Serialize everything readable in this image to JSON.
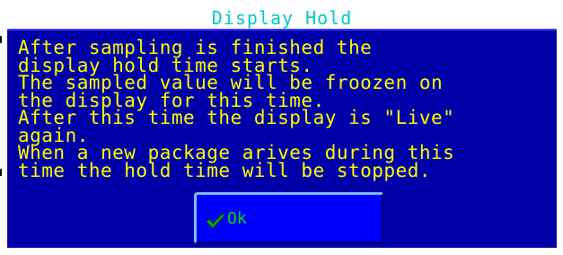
{
  "dialog": {
    "title": "Display Hold",
    "message_lines": [
      "After sampling is finished the",
      "display hold time starts.",
      "The sampled value will be froozen on",
      "the display for this time.",
      "After this time the display is \"Live\"",
      "again.",
      "When a new package arives during this",
      "time the hold time will be stopped."
    ],
    "ok_button": {
      "label": "Ok",
      "icon": "checkmark-icon"
    }
  },
  "colors": {
    "dialog_background": "#0000a8",
    "title_text": "#00c8c8",
    "message_text": "#ffff00",
    "button_background": "#0000ff",
    "button_label": "#00e000",
    "checkmark": "#00b000"
  }
}
